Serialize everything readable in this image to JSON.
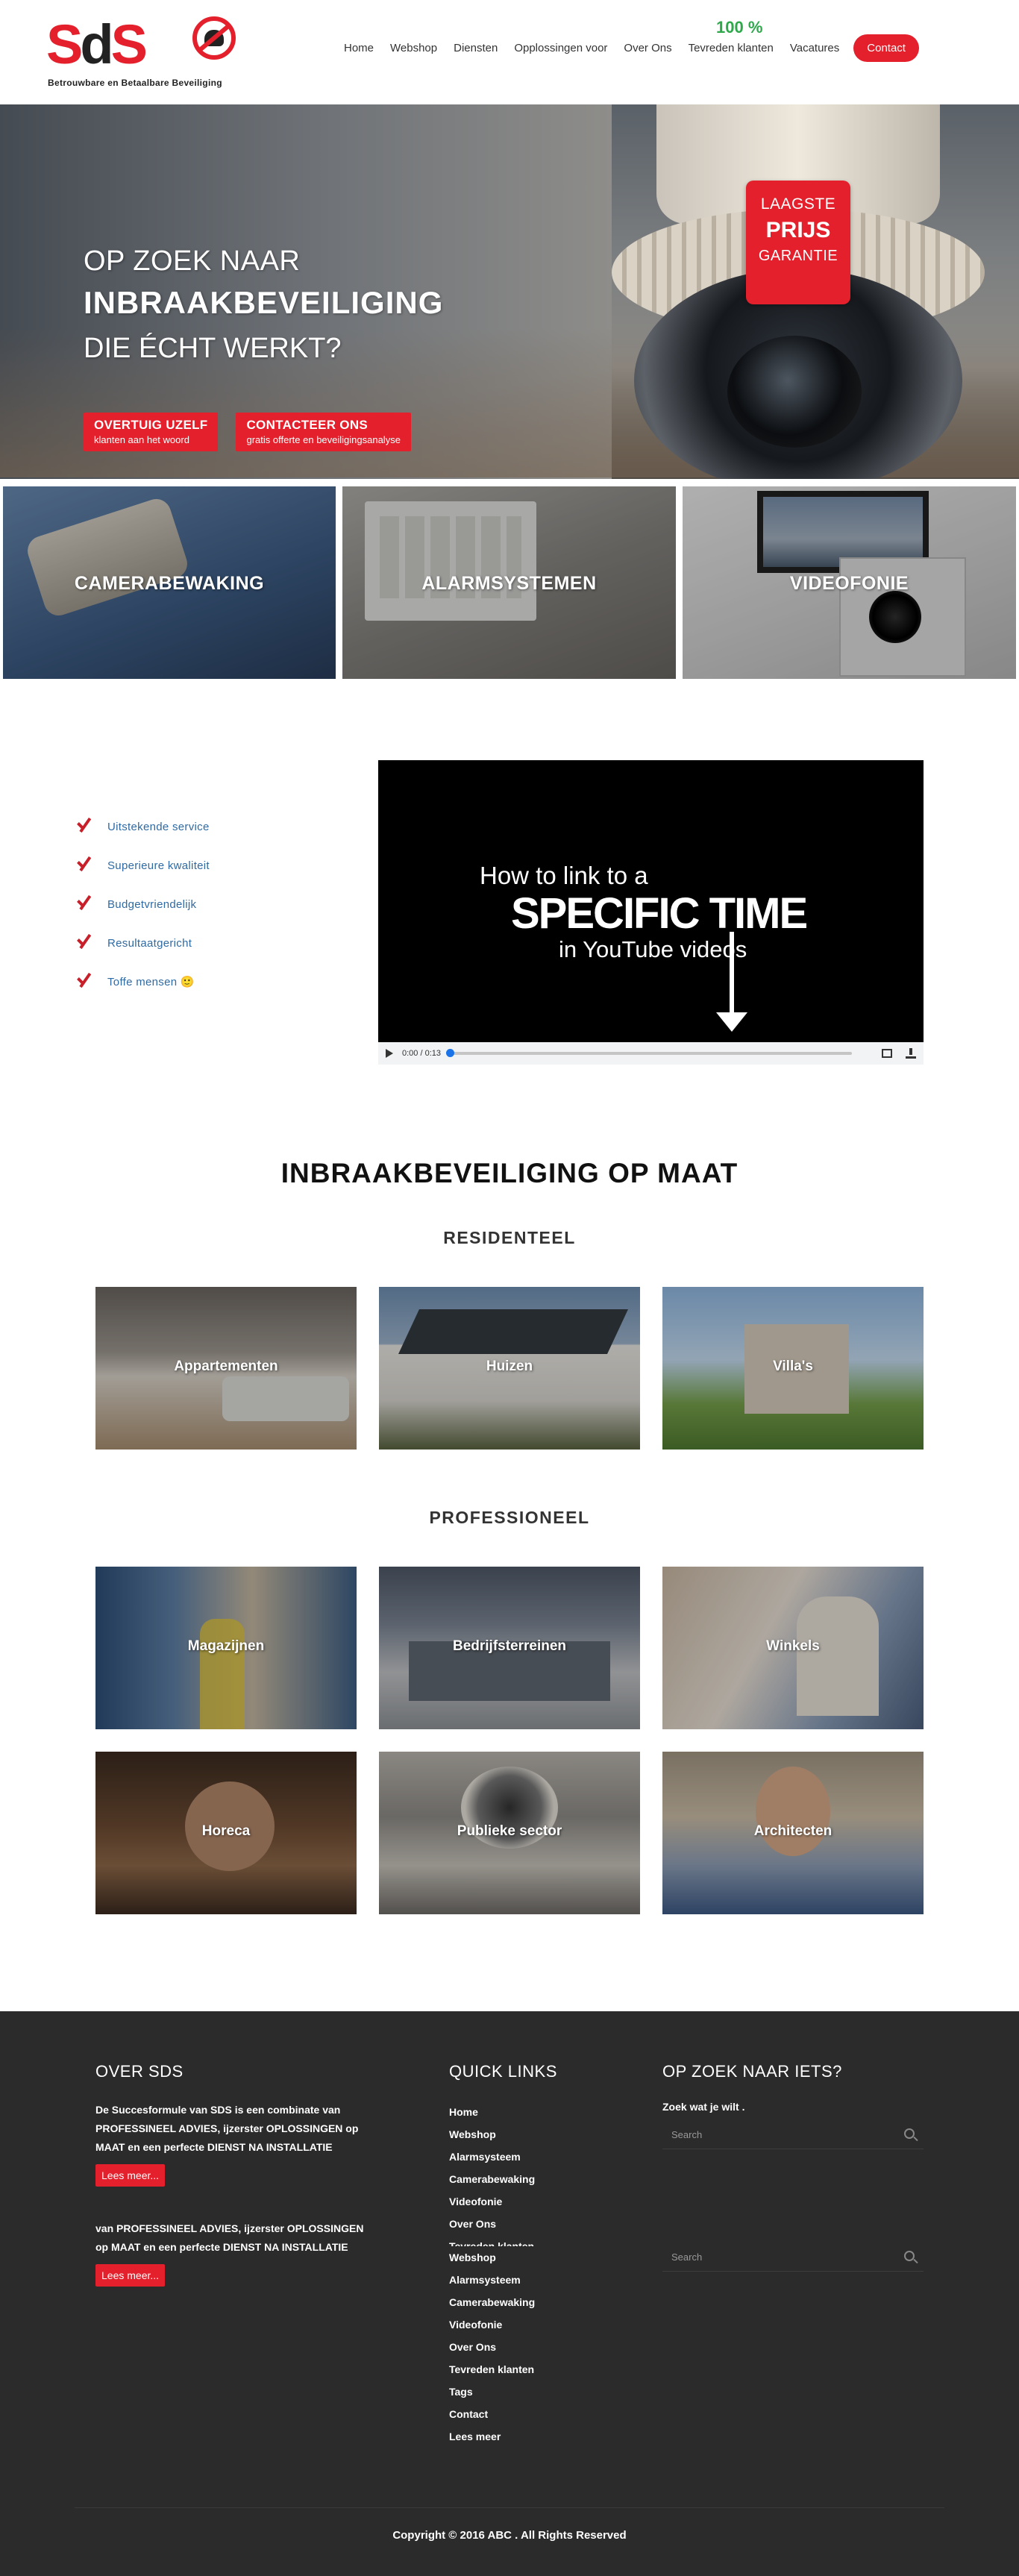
{
  "header": {
    "logo_text": "SdS",
    "logo_tagline": "Betrouwbare en Betaalbare Beveiliging",
    "percent": "100 %",
    "nav": [
      "Home",
      "Webshop",
      "Diensten",
      "Opplossingen voor",
      "Over Ons",
      "Tevreden klanten",
      "Vacatures"
    ],
    "contact_label": "Contact"
  },
  "hero": {
    "line1": "OP ZOEK NAAR",
    "line2": "INBRAAKBEVEILIGING",
    "line3": "DIE ÉCHT WERKT?",
    "btn1_title": "OVERTUIG UZELF",
    "btn1_sub": "klanten aan het woord",
    "btn2_title": "CONTACTEER ONS",
    "btn2_sub": "gratis offerte en beveiligingsanalyse",
    "badge": [
      "LAAGSTE",
      "PRIJS",
      "GARANTIE"
    ]
  },
  "categories": [
    "CAMERABEWAKING",
    "ALARMSYSTEMEN",
    "VIDEOFONIE"
  ],
  "features": [
    "Uitstekende service",
    "Superieure kwaliteit",
    "Budgetvriendelijk",
    "Resultaatgericht",
    "Toffe mensen 🙂"
  ],
  "video": {
    "line1": "How to link to a",
    "line2": "SPECIFIC TIME",
    "line3": "in YouTube videos",
    "time": "0:00 / 0:13",
    "progress": 0
  },
  "section": {
    "title": "INBRAAKBEVEILIGING OP MAAT",
    "residential_title": "RESIDENTEEL",
    "residential": [
      "Appartementen",
      "Huizen",
      "Villa's"
    ],
    "professional_title": "PROFESSIONEEL",
    "professional": [
      "Magazijnen",
      "Bedrijfsterreinen",
      "Winkels",
      "Horeca",
      "Publieke sector",
      "Architecten"
    ]
  },
  "footer": {
    "about_title": "OVER SDS",
    "about_text": "De Succesformule van SDS is een combinate van PROFESSINEEL ADVIES, ijzerster OPLOSSINGEN op MAAT en een perfecte DIENST NA INSTALLATIE",
    "about_text2": "van PROFESSINEEL ADVIES, ijzerster OPLOSSINGEN op MAAT en een perfecte DIENST NA INSTALLATIE",
    "more_label": "Lees meer...",
    "links_title": "QUICK LINKS",
    "links1": [
      "Home",
      "Webshop",
      "Alarmsysteem",
      "Camerabewaking",
      "Videofonie",
      "Over Ons",
      "Tevreden klanten"
    ],
    "links2": [
      "Webshop",
      "Alarmsysteem",
      "Camerabewaking",
      "Videofonie",
      "Over Ons",
      "Tevreden klanten",
      "Tags",
      "Contact",
      "Lees meer"
    ],
    "search_title": "OP ZOEK NAAR IETS?",
    "search_text": "Zoek wat je wilt .",
    "search_placeholder": "Search",
    "copyright": "Copyright © 2016 ABC . All Rights Reserved"
  },
  "colors": {
    "accent": "#e3202b",
    "green": "#2ea84b",
    "footer_bg": "#2b2b2b",
    "feature_text": "#2f6aa3"
  }
}
